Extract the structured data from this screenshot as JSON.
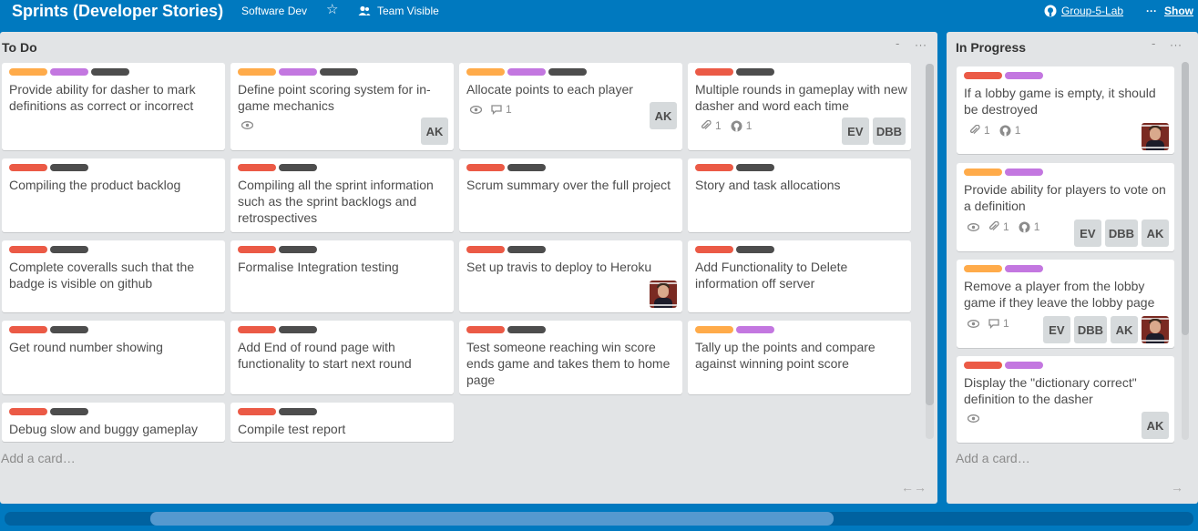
{
  "header": {
    "title": "Sprints (Developer Stories)",
    "org": "Software Dev",
    "visibility": "Team Visible",
    "team_link": "Group-5-Lab",
    "show_menu": "Show"
  },
  "colors": {
    "board_bg": "#0079bf",
    "list_bg": "#e2e4e6",
    "label_orange": "#ffab4a",
    "label_purple": "#c377e0",
    "label_red": "#eb5a46",
    "label_dark": "#4d4d4d"
  },
  "icons": {
    "star": "star-icon",
    "team": "team-icon",
    "github": "github-icon",
    "more": "ellipsis-icon",
    "watch": "eye-icon",
    "comment": "comment-icon",
    "attachment": "paperclip-icon"
  },
  "lists": [
    {
      "title": "To Do",
      "minimize": "-",
      "more": "···",
      "add_card": "Add a card…",
      "cards": [
        {
          "title": "Provide ability for dasher to mark definitions as correct or incorrect",
          "labels": [
            "orange",
            "purple",
            "dark"
          ]
        },
        {
          "title": "Define point scoring system for in-game mechanics",
          "labels": [
            "orange",
            "purple",
            "dark"
          ],
          "avatars": [
            "AK"
          ]
        },
        {
          "title": "Allocate points to each player",
          "labels": [
            "orange",
            "purple",
            "dark"
          ],
          "comments": "1",
          "avatars": [
            "AK"
          ]
        },
        {
          "title": "Multiple rounds in gameplay with new dasher and word each time",
          "labels": [
            "red",
            "dark"
          ],
          "attachments": "1",
          "github": "1",
          "avatars": [
            "EV",
            "DBB"
          ]
        },
        {
          "title": "Compiling the product backlog",
          "labels": [
            "red",
            "dark"
          ]
        },
        {
          "title": "Compiling all the sprint information such as the sprint backlogs and retrospectives",
          "labels": [
            "red",
            "dark"
          ]
        },
        {
          "title": "Scrum summary over the full project",
          "labels": [
            "red",
            "dark"
          ]
        },
        {
          "title": "Story and task allocations",
          "labels": [
            "red",
            "dark"
          ]
        },
        {
          "title": "Complete coveralls such that the badge is visible on github",
          "labels": [
            "red",
            "dark"
          ]
        },
        {
          "title": "Formalise Integration testing",
          "labels": [
            "red",
            "dark"
          ]
        },
        {
          "title": "Set up travis to deploy to Heroku",
          "labels": [
            "red",
            "dark"
          ]
        },
        {
          "title": "Add Functionality to Delete information off server",
          "labels": [
            "red",
            "dark"
          ]
        },
        {
          "title": "Get round number showing",
          "labels": [
            "red",
            "dark"
          ]
        },
        {
          "title": "Add End of round page with functionality to start next round",
          "labels": [
            "red",
            "dark"
          ]
        },
        {
          "title": "Test someone reaching win score ends game and takes them to home page",
          "labels": [
            "red",
            "dark"
          ]
        },
        {
          "title": "Tally up the points and compare against winning point score",
          "labels": [
            "orange",
            "purple"
          ]
        },
        {
          "title": "Debug slow and buggy gameplay",
          "labels": [
            "red",
            "dark"
          ]
        },
        {
          "title": "Compile test report",
          "labels": [
            "red",
            "dark"
          ]
        }
      ]
    },
    {
      "title": "In Progress",
      "minimize": "-",
      "more": "···",
      "add_card": "Add a card…",
      "cards": [
        {
          "title": "If a lobby game is empty, it should be destroyed",
          "labels": [
            "red",
            "purple"
          ],
          "attachments": "1",
          "github": "1"
        },
        {
          "title": "Provide ability for players to vote on a definition",
          "labels": [
            "orange",
            "purple"
          ],
          "attachments": "1",
          "github": "1",
          "avatars": [
            "EV",
            "DBB",
            "AK"
          ]
        },
        {
          "title": "Remove a player from the lobby game if they leave the lobby page",
          "labels": [
            "orange",
            "purple"
          ],
          "comments": "1",
          "avatars": [
            "EV",
            "DBB",
            "AK"
          ]
        },
        {
          "title": "Display the \"dictionary correct\" definition to the dasher",
          "labels": [
            "red",
            "purple"
          ],
          "avatars": [
            "AK"
          ]
        }
      ]
    }
  ]
}
